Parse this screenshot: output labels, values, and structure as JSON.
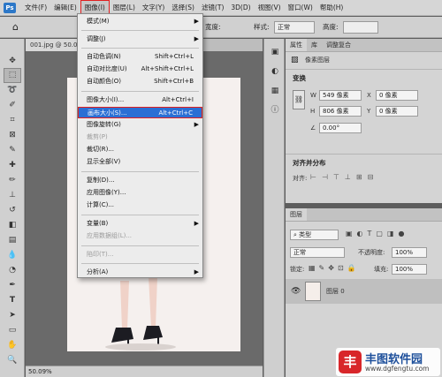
{
  "menubar": {
    "logo": "Ps",
    "items": [
      "文件(F)",
      "编辑(E)",
      "图像(I)",
      "图层(L)",
      "文字(Y)",
      "选择(S)",
      "滤镜(T)",
      "3D(D)",
      "视图(V)",
      "窗口(W)",
      "帮助(H)"
    ],
    "active_index": 2
  },
  "options_bar": {
    "width_label": "宽度:",
    "style_label": "样式:",
    "style_value": "正常",
    "height_label": "高度:",
    "home_icon": "home-icon"
  },
  "document": {
    "tab_label": "001.jpg @ 50.09%",
    "zoom": "50.09%"
  },
  "image_menu": {
    "items": [
      {
        "label": "模式(M)",
        "shortcut": "",
        "submenu": true,
        "disabled": false
      },
      {
        "label": "调整(J)",
        "shortcut": "",
        "submenu": true,
        "disabled": false
      },
      {
        "label": "自动色调(N)",
        "shortcut": "Shift+Ctrl+L",
        "submenu": false,
        "disabled": false
      },
      {
        "label": "自动对比度(U)",
        "shortcut": "Alt+Shift+Ctrl+L",
        "submenu": false,
        "disabled": false
      },
      {
        "label": "自动颜色(O)",
        "shortcut": "Shift+Ctrl+B",
        "submenu": false,
        "disabled": false
      },
      {
        "label": "图像大小(I)...",
        "shortcut": "Alt+Ctrl+I",
        "submenu": false,
        "disabled": false
      },
      {
        "label": "画布大小(S)...",
        "shortcut": "Alt+Ctrl+C",
        "submenu": false,
        "disabled": false,
        "highlighted": true
      },
      {
        "label": "图像旋转(G)",
        "shortcut": "",
        "submenu": true,
        "disabled": false
      },
      {
        "label": "裁剪(P)",
        "shortcut": "",
        "submenu": false,
        "disabled": true
      },
      {
        "label": "裁切(R)...",
        "shortcut": "",
        "submenu": false,
        "disabled": false
      },
      {
        "label": "显示全部(V)",
        "shortcut": "",
        "submenu": false,
        "disabled": false
      },
      {
        "label": "复制(D)...",
        "shortcut": "",
        "submenu": false,
        "disabled": false
      },
      {
        "label": "应用图像(Y)...",
        "shortcut": "",
        "submenu": false,
        "disabled": false
      },
      {
        "label": "计算(C)...",
        "shortcut": "",
        "submenu": false,
        "disabled": false
      },
      {
        "label": "变量(B)",
        "shortcut": "",
        "submenu": true,
        "disabled": false
      },
      {
        "label": "应用数据组(L)...",
        "shortcut": "",
        "submenu": false,
        "disabled": true
      },
      {
        "label": "陷印(T)...",
        "shortcut": "",
        "submenu": false,
        "disabled": true
      },
      {
        "label": "分析(A)",
        "shortcut": "",
        "submenu": true,
        "disabled": false
      }
    ]
  },
  "properties_panel": {
    "tabs": [
      "属性",
      "库",
      "调整复合"
    ],
    "subtitle": "像素图层",
    "transform_title": "变换",
    "w_label": "W",
    "w_value": "549 像素",
    "x_label": "X",
    "x_value": "0 像素",
    "h_label": "H",
    "h_value": "806 像素",
    "y_label": "Y",
    "y_value": "0 像素",
    "angle_value": "0.00°",
    "align_title": "对齐并分布",
    "align_label": "对齐:"
  },
  "layers_panel": {
    "title": "图层",
    "filter_label": "类型",
    "blend_mode": "正常",
    "opacity_label": "不透明度:",
    "opacity_value": "100%",
    "lock_label": "锁定:",
    "fill_label": "填充:",
    "fill_value": "100%",
    "layer_name": "图层 0"
  },
  "watermark": {
    "logo_char": "丰",
    "title": "丰图软件园",
    "url": "www.dgfengtu.com"
  },
  "colors": {
    "accent": "#2b6fd4",
    "highlight_border": "#e02020"
  }
}
